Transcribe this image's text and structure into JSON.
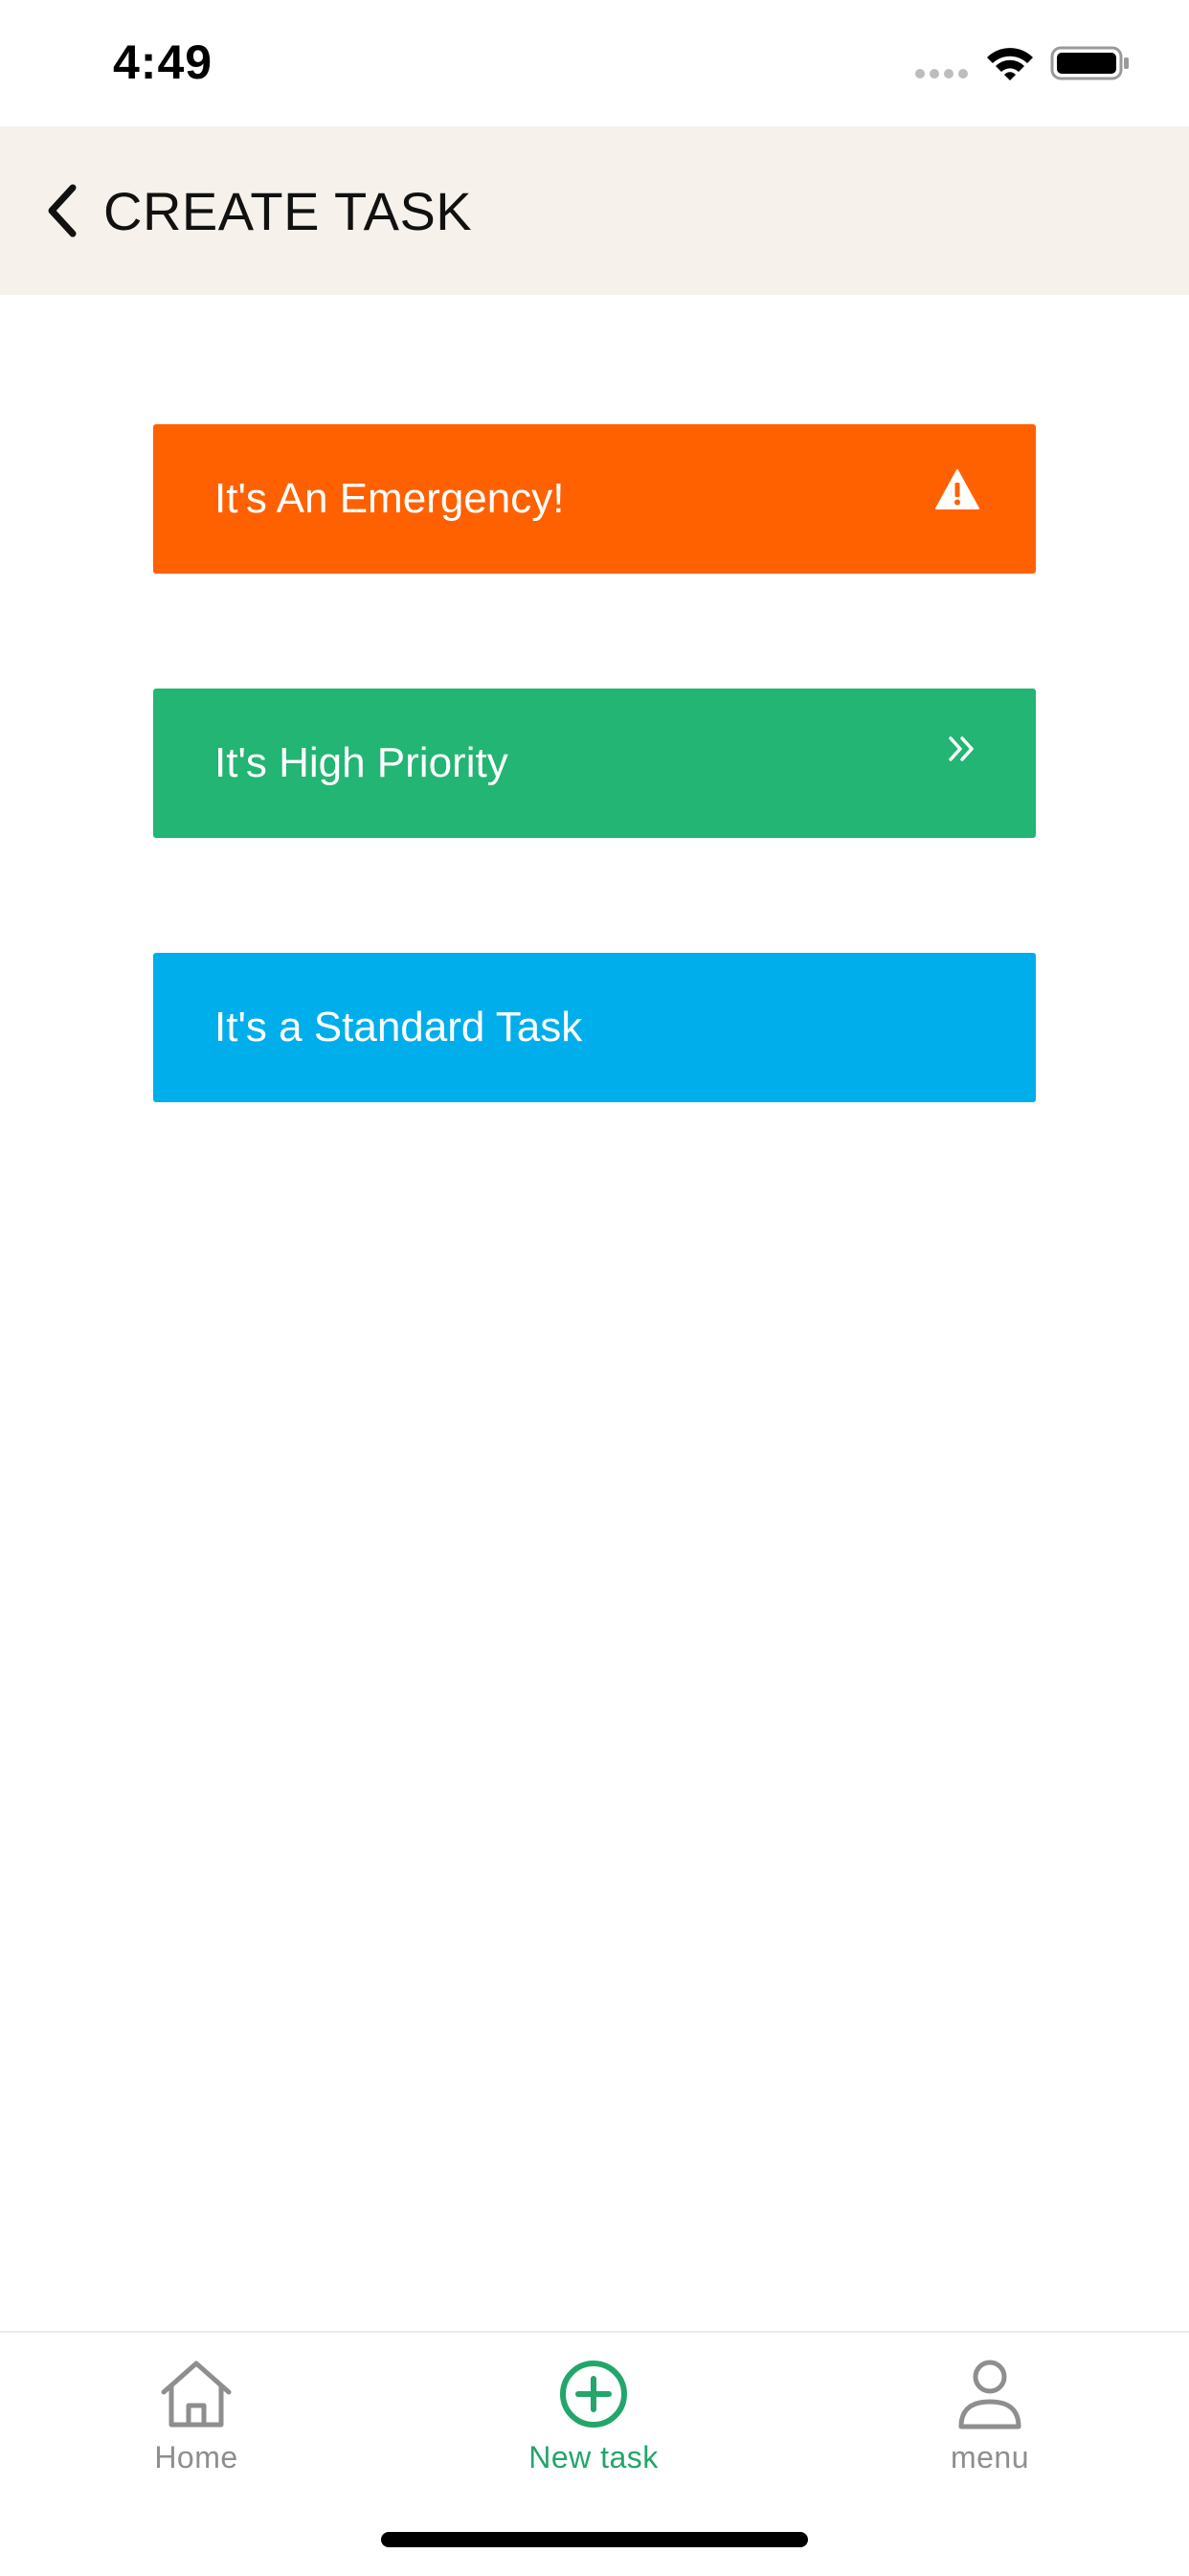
{
  "status_bar": {
    "time": "4:49"
  },
  "header": {
    "title": "CREATE TASK",
    "back_icon": "chevron-left-icon"
  },
  "task_options": [
    {
      "label": "It's An Emergency!",
      "color": "#ff6100",
      "icon": "warning-icon"
    },
    {
      "label": "It's High Priority",
      "color": "#22b573",
      "icon": "double-chevron-right-icon"
    },
    {
      "label": "It's a Standard Task",
      "color": "#00aeeb",
      "icon": ""
    }
  ],
  "tab_bar": {
    "tabs": [
      {
        "label": "Home",
        "icon": "home-icon",
        "active": false
      },
      {
        "label": "New task",
        "icon": "plus-circle-icon",
        "active": true
      },
      {
        "label": "menu",
        "icon": "user-icon",
        "active": false
      }
    ],
    "active_color": "#22a66a",
    "inactive_color": "#8e8e8e"
  }
}
